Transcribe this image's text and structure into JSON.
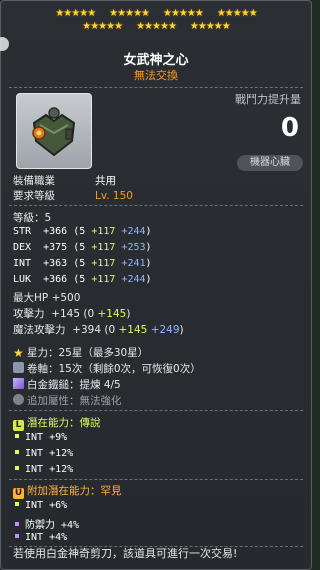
{
  "header": {
    "stars_row1": [
      "★★★★★",
      "★★★★★",
      "★★★★★",
      "★★★★★"
    ],
    "stars_row2": [
      "★★★★★",
      "★★★★★",
      "★★★★★"
    ],
    "title": "女武神之心",
    "subtitle": "無法交換"
  },
  "combat_power": {
    "label": "戰鬥力提升量",
    "value": "0",
    "badge": "機器心臟"
  },
  "equip_info": {
    "job_label": "裝備職業",
    "job_value": "共用",
    "level_label": "要求等級",
    "level_value": "Lv. 150"
  },
  "stats": {
    "grade": "等級：5",
    "lines": [
      {
        "name": "STR",
        "total": "+366",
        "base": "5",
        "bonus": "+117",
        "extra": "+244"
      },
      {
        "name": "DEX",
        "total": "+375",
        "base": "5",
        "bonus": "+117",
        "extra": "+253"
      },
      {
        "name": "INT",
        "total": "+363",
        "base": "5",
        "bonus": "+117",
        "extra": "+241"
      },
      {
        "name": "LUK",
        "total": "+366",
        "base": "5",
        "bonus": "+117",
        "extra": "+244"
      }
    ],
    "maxhp": "最大HP  +500",
    "atk": {
      "label": "攻擊力",
      "total": "+145",
      "base": "0",
      "bonus": "+145"
    },
    "matk": {
      "label": "魔法攻擊力",
      "total": "+394",
      "base": "0",
      "bonus": "+145",
      "extra": "+249"
    }
  },
  "enhance": {
    "starforce": "星力：25星（最多30星）",
    "scroll": "卷軸：15次（剩餘0次，可恢復0次）",
    "hammer": "白金鐵鎚：提煉 4/5",
    "extra": "追加屬性：無法強化"
  },
  "potential": {
    "badge": "L",
    "header": "潛在能力：傳說",
    "lines": [
      "INT +9%",
      "INT +12%",
      "INT +12%"
    ]
  },
  "additional": {
    "badge": "U",
    "header": "附加潛在能力：罕見",
    "lines": [
      "INT +6%",
      "防禦力 +4%",
      "INT +4%"
    ]
  },
  "footer": {
    "notice": "若使用白金神奇剪刀，該道具可進行一次交易!"
  }
}
